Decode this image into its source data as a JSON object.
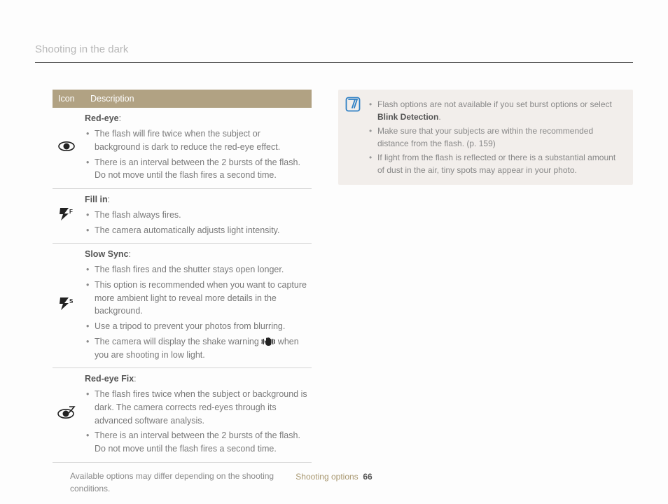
{
  "header": {
    "title": "Shooting in the dark"
  },
  "table": {
    "headers": {
      "icon": "Icon",
      "desc": "Description"
    },
    "rows": [
      {
        "title": "Red-eye",
        "bullets": [
          "The flash will fire twice when the subject or background is dark to reduce the red-eye effect.",
          "There is an interval between the 2 bursts of the flash. Do not move until the flash fires a second time."
        ]
      },
      {
        "title": "Fill in",
        "bullets": [
          "The flash always fires.",
          "The camera automatically adjusts light intensity."
        ]
      },
      {
        "title": "Slow Sync",
        "bullets": [
          "The flash fires and the shutter stays open longer.",
          "This option is recommended when you want to capture more ambient light to reveal more details in the background.",
          "Use a tripod to prevent your photos from blurring.",
          "The camera will display the shake warning  when you are shooting in low light."
        ]
      },
      {
        "title": "Red-eye Fix",
        "bullets": [
          "The flash fires twice when the subject or background is dark. The camera corrects red-eyes through its advanced software analysis.",
          "There is an interval between the 2 bursts of the flash. Do not move until the flash fires a second time."
        ]
      }
    ]
  },
  "footnote": "Available options may differ depending on the shooting conditions.",
  "notes": {
    "items": [
      {
        "pre": "Flash options are not available if you set burst options or select ",
        "strong": "Blink Detection",
        "post": "."
      },
      {
        "pre": "Make sure that your subjects are within the recommended distance from the flash. (p. 159)",
        "strong": "",
        "post": ""
      },
      {
        "pre": "If light from the flash is reflected or there is a substantial amount of dust in the air, tiny spots may appear in your photo.",
        "strong": "",
        "post": ""
      }
    ]
  },
  "footer": {
    "section": "Shooting options",
    "page": "66"
  }
}
